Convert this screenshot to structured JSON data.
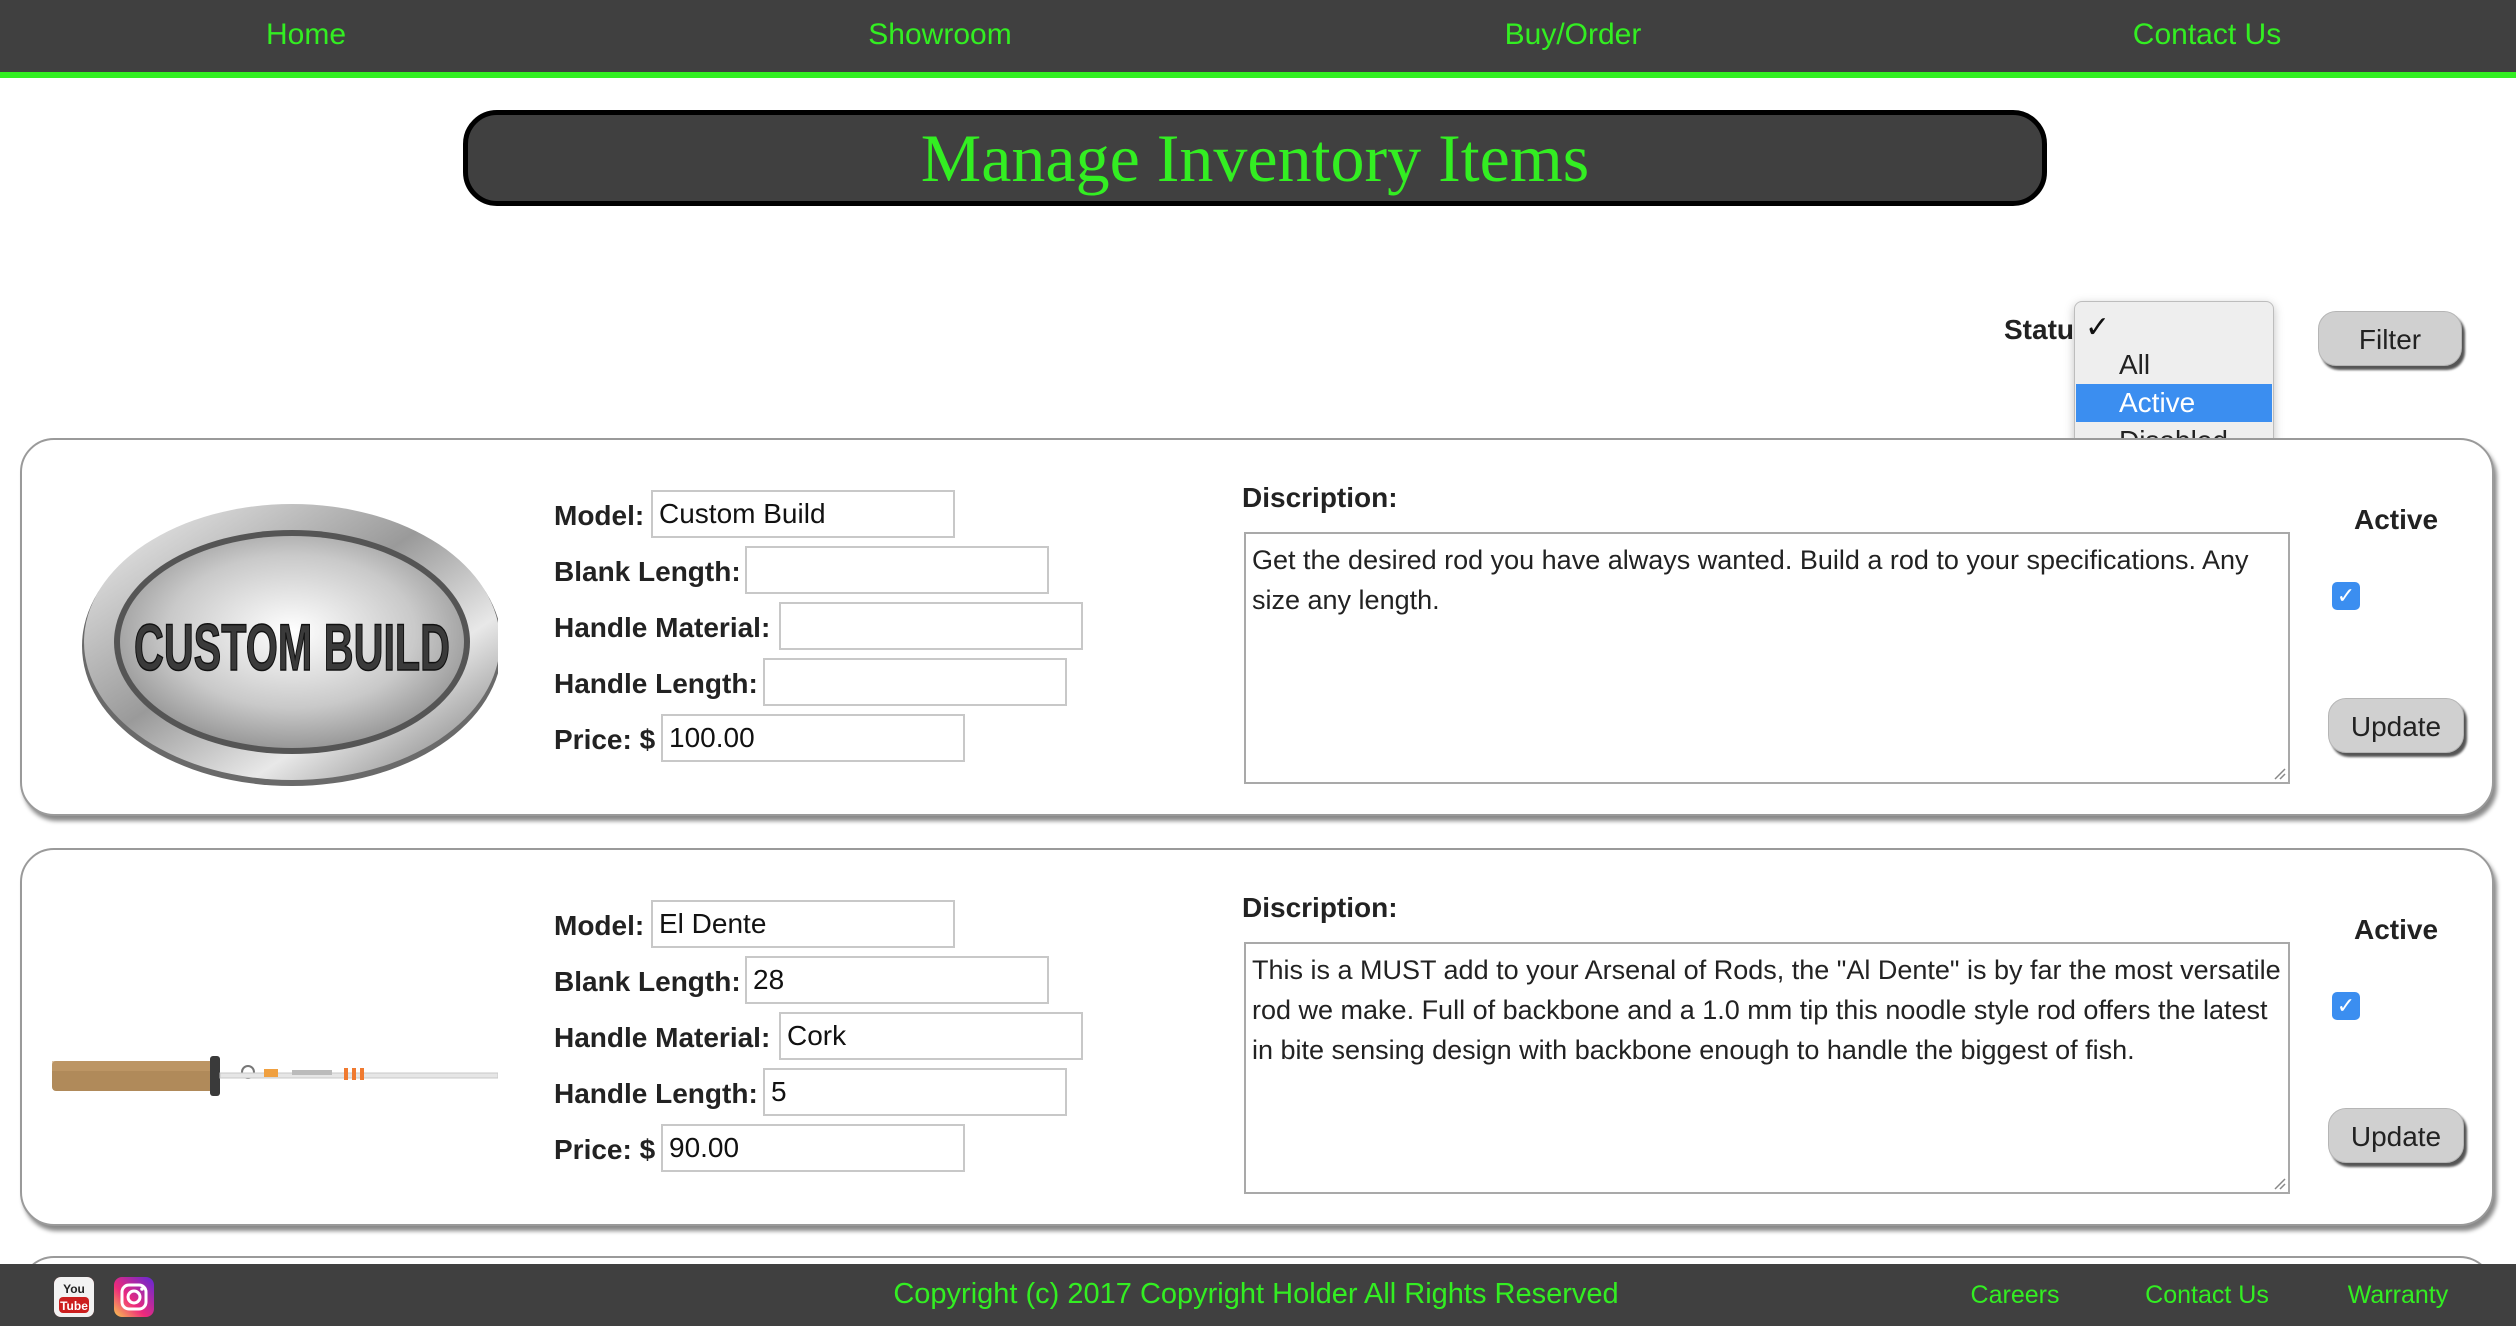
{
  "nav": {
    "items": [
      {
        "label": "Home"
      },
      {
        "label": "Showroom"
      },
      {
        "label": "Buy/Order"
      },
      {
        "label": "Contact Us"
      }
    ]
  },
  "page": {
    "title": "Manage Inventory Items"
  },
  "filter": {
    "status_label": "Statu",
    "checkmark": "✓",
    "options": [
      "All",
      "Active",
      "Disabled"
    ],
    "selected": "Active",
    "button_label": "Filter"
  },
  "items": [
    {
      "image_label": "CUSTOM BUILD",
      "model_label": "Model:",
      "model": "Custom Build",
      "blank_length_label": "Blank Length:",
      "blank_length": "",
      "handle_material_label": "Handle Material:",
      "handle_material": "",
      "handle_length_label": "Handle Length:",
      "handle_length": "",
      "price_label": "Price: $",
      "price": "100.00",
      "description_label": "Discription:",
      "description": "Get the desired rod you have always wanted.  Build a rod to your specifications.  Any size any length.",
      "active_label": "Active",
      "active": true,
      "update_label": "Update"
    },
    {
      "image_label": "",
      "model_label": "Model:",
      "model": "El Dente",
      "blank_length_label": "Blank Length:",
      "blank_length": "28",
      "handle_material_label": "Handle Material:",
      "handle_material": "Cork",
      "handle_length_label": "Handle Length:",
      "handle_length": "5",
      "price_label": "Price: $",
      "price": "90.00",
      "description_label": "Discription:",
      "description": "This is a MUST add to your Arsenal of Rods, the \"Al Dente\" is by far the most versatile rod we make. Full of backbone and a 1.0 mm tip this noodle style rod offers the latest in bite sensing design with backbone enough to handle the biggest of fish.",
      "active_label": "Active",
      "active": true,
      "update_label": "Update"
    }
  ],
  "footer": {
    "copyright": "Copyright (c) 2017 Copyright Holder All Rights Reserved",
    "links": [
      {
        "label": "Careers"
      },
      {
        "label": "Contact Us"
      },
      {
        "label": "Warranty"
      }
    ],
    "social_icons": [
      "youtube-icon",
      "instagram-icon"
    ],
    "youtube_icon_text_top": "You",
    "youtube_icon_text_bottom": "Tube"
  },
  "colors": {
    "accent_green": "#33ee22",
    "bar_dark": "#404040",
    "select_blue": "#3b8ef0"
  }
}
